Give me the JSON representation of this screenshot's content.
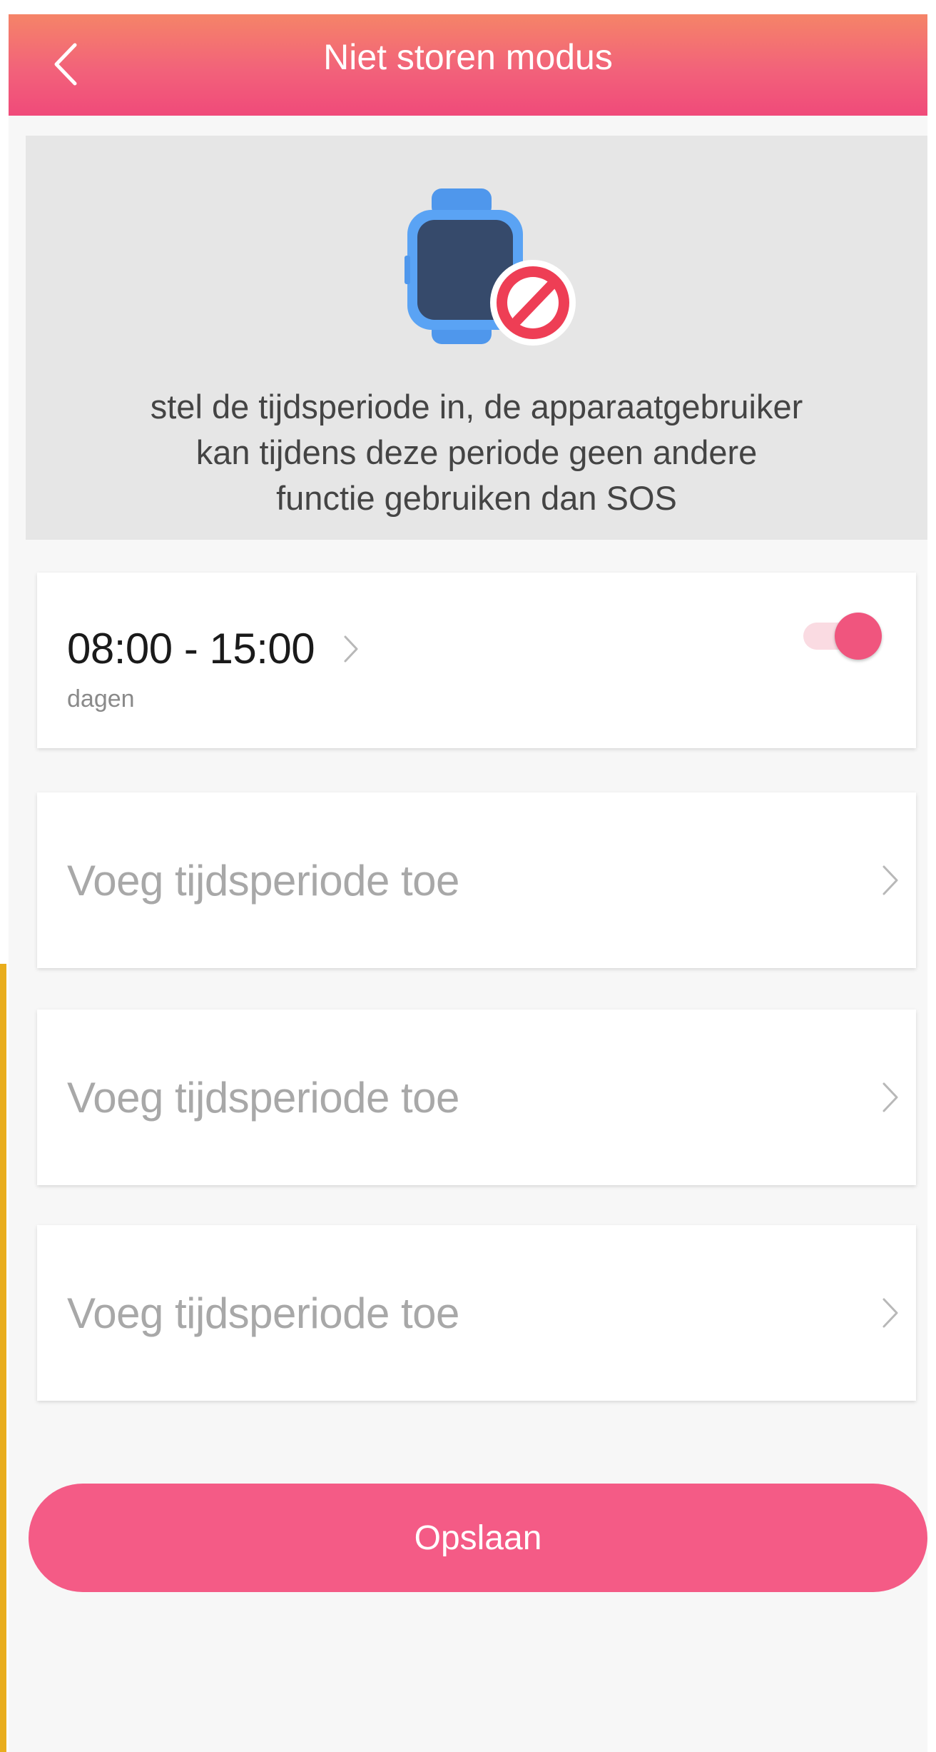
{
  "header": {
    "title": "Niet storen modus",
    "back_icon": "chevron-left-icon"
  },
  "info": {
    "illustration_icons": [
      "smartwatch-icon",
      "prohibited-icon"
    ],
    "line1": "stel de tijdsperiode in, de apparaatgebruiker",
    "line2": "kan tijdens deze periode geen andere",
    "line3": "functie gebruiken dan SOS"
  },
  "periods": [
    {
      "time": "08:00 - 15:00",
      "days": "dagen",
      "enabled": true
    }
  ],
  "add_slots": [
    {
      "label": "Voeg tijdsperiode toe"
    },
    {
      "label": "Voeg tijdsperiode toe"
    },
    {
      "label": "Voeg tijdsperiode toe"
    }
  ],
  "save_button": {
    "label": "Opslaan"
  },
  "colors": {
    "header_gradient_start": "#f58468",
    "header_gradient_end": "#f04a7a",
    "accent": "#f0557e",
    "save_button": "#f45b86",
    "banner_background": "#e6e6e6",
    "side_accent": "#e9ad1c"
  }
}
